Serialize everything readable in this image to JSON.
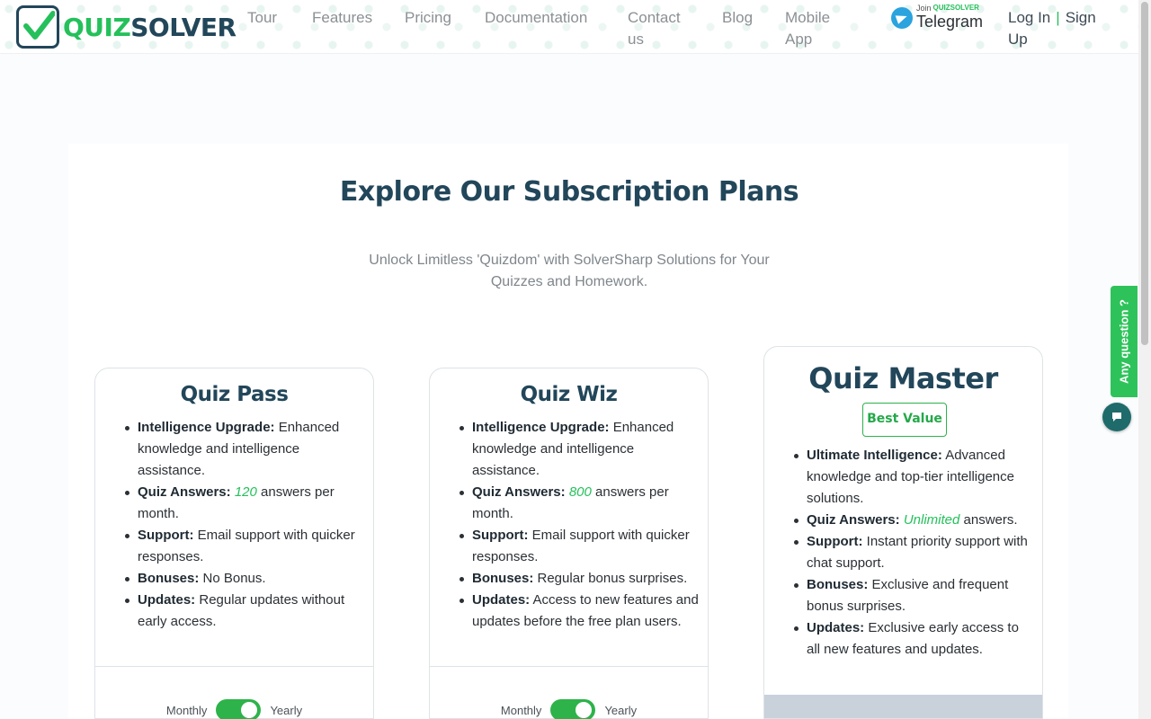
{
  "header": {
    "logo": {
      "part1": "QUIZ",
      "part2": "SOLVER"
    },
    "nav": [
      {
        "label": "Tour"
      },
      {
        "label": "Features"
      },
      {
        "label": "Pricing"
      },
      {
        "label": "Documentation"
      },
      {
        "label": "Contact us"
      },
      {
        "label": "Blog"
      },
      {
        "label": "Mobile App"
      }
    ],
    "telegram": {
      "join": "Join",
      "brand": "QUIZSOLVER",
      "label": "Telegram"
    },
    "auth": {
      "login": "Log In",
      "separator": "|",
      "signup": "Sign Up"
    }
  },
  "main": {
    "title": "Explore Our Subscription Plans",
    "subtitle": "Unlock Limitless 'Quizdom' with SolverSharp Solutions for Your Quizzes and Homework."
  },
  "plans": [
    {
      "name": "Quiz Pass",
      "features": [
        {
          "label": "Intelligence Upgrade:",
          "text": " Enhanced knowledge and intelligence assistance."
        },
        {
          "label": "Quiz Answers:",
          "highlight": "120",
          "text": " answers per month."
        },
        {
          "label": "Support:",
          "text": " Email support with quicker responses."
        },
        {
          "label": "Bonuses:",
          "text": " No Bonus."
        },
        {
          "label": "Updates:",
          "text": " Regular updates without early access."
        }
      ],
      "toggle": {
        "left": "Monthly",
        "right": "Yearly"
      }
    },
    {
      "name": "Quiz Wiz",
      "features": [
        {
          "label": "Intelligence Upgrade:",
          "text": " Enhanced knowledge and intelligence assistance."
        },
        {
          "label": "Quiz Answers:",
          "highlight": "800",
          "text": " answers per month."
        },
        {
          "label": "Support:",
          "text": " Email support with quicker responses."
        },
        {
          "label": "Bonuses:",
          "text": " Regular bonus surprises."
        },
        {
          "label": "Updates:",
          "text": " Access to new features and updates before the free plan users."
        }
      ],
      "toggle": {
        "left": "Monthly",
        "right": "Yearly"
      }
    },
    {
      "name": "Quiz Master",
      "badge": "Best Value",
      "features": [
        {
          "label": "Ultimate Intelligence:",
          "text": " Advanced knowledge and top-tier intelligence solutions."
        },
        {
          "label": "Quiz Answers:",
          "highlight": "Unlimited",
          "text": " answers."
        },
        {
          "label": "Support:",
          "text": " Instant priority support with chat support."
        },
        {
          "label": "Bonuses:",
          "text": " Exclusive and frequent bonus surprises."
        },
        {
          "label": "Updates:",
          "text": " Exclusive early access to all new features and updates."
        }
      ]
    }
  ],
  "widget": {
    "any_question": "Any question ?",
    "chat_icon": "chat-bubble-icon"
  },
  "colors": {
    "brand_dark": "#22465a",
    "brand_green": "#25c05b",
    "toggle_green": "#2db34a"
  }
}
